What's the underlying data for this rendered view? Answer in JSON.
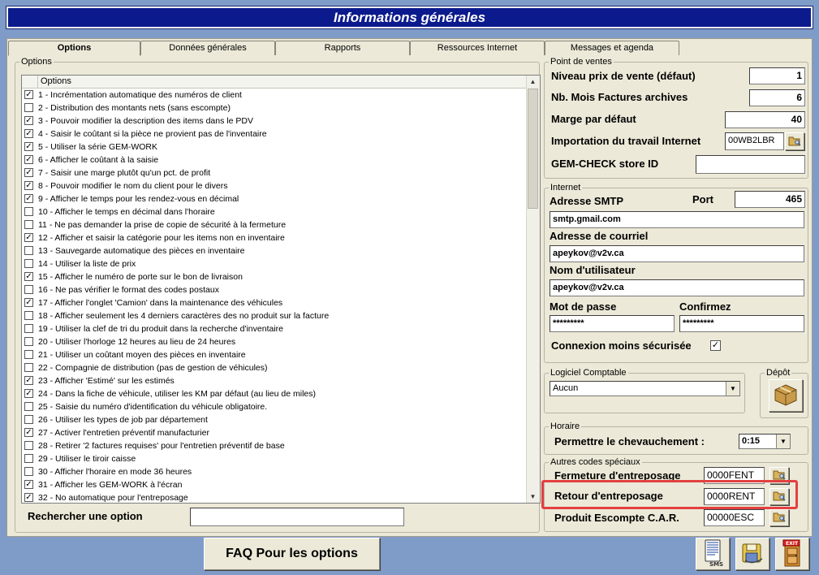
{
  "window": {
    "title": "Informations générales"
  },
  "tabs": [
    {
      "label": "Options"
    },
    {
      "label": "Données générales"
    },
    {
      "label": "Rapports"
    },
    {
      "label": "Ressources Internet"
    },
    {
      "label": "Messages et agenda"
    }
  ],
  "options_group": {
    "label": "Options",
    "column_header": "Options",
    "items": [
      {
        "text": "1 - Incrémentation automatique des numéros de client",
        "checked": true
      },
      {
        "text": "2 - Distribution des montants nets (sans escompte)",
        "checked": false
      },
      {
        "text": "3 - Pouvoir modifier la description des items dans le PDV",
        "checked": true
      },
      {
        "text": "4 - Saisir le coûtant si la pièce ne provient pas de l'inventaire",
        "checked": true
      },
      {
        "text": "5 - Utiliser la série GEM-WORK",
        "checked": true
      },
      {
        "text": "6 - Afficher le coûtant à la saisie",
        "checked": true
      },
      {
        "text": "7 - Saisir une marge plutôt qu'un pct. de profit",
        "checked": true
      },
      {
        "text": "8 - Pouvoir modifier le nom du client pour le divers",
        "checked": true
      },
      {
        "text": "9 - Afficher le temps pour les rendez-vous en décimal",
        "checked": true
      },
      {
        "text": "10 - Afficher le temps en décimal dans l'horaire",
        "checked": false
      },
      {
        "text": "11 - Ne pas demander la prise de copie de sécurité à la fermeture",
        "checked": false
      },
      {
        "text": "12 - Afficher et saisir la catégorie pour les items non en inventaire",
        "checked": true
      },
      {
        "text": "13 - Sauvegarde automatique des pièces en inventaire",
        "checked": false
      },
      {
        "text": "14 - Utiliser la liste de prix",
        "checked": false
      },
      {
        "text": "15 - Afficher le numéro de porte sur le bon de livraison",
        "checked": true
      },
      {
        "text": "16 - Ne pas vérifier le format des codes postaux",
        "checked": false
      },
      {
        "text": "17 - Afficher l'onglet 'Camion' dans la maintenance des véhicules",
        "checked": true
      },
      {
        "text": "18 - Afficher seulement les 4 derniers caractères des no produit sur la facture",
        "checked": false
      },
      {
        "text": "19 - Utiliser la clef de tri du produit dans la recherche d'inventaire",
        "checked": false
      },
      {
        "text": "20 - Utiliser l'horloge 12 heures au lieu de 24 heures",
        "checked": false
      },
      {
        "text": "21 - Utiliser un coûtant moyen des pièces en inventaire",
        "checked": false
      },
      {
        "text": "22 - Compagnie de distribution (pas de gestion de véhicules)",
        "checked": false
      },
      {
        "text": "23 - Afficher 'Estimé' sur les estimés",
        "checked": true
      },
      {
        "text": "24 - Dans la fiche de véhicule, utiliser les KM par défaut (au lieu de miles)",
        "checked": true
      },
      {
        "text": "25 - Saisie du numéro d'identification du véhicule obligatoire.",
        "checked": false
      },
      {
        "text": "26 - Utiliser les types de job par département",
        "checked": false
      },
      {
        "text": "27 - Activer l'entretien préventif manufacturier",
        "checked": true
      },
      {
        "text": "28 - Retirer '2 factures requises' pour l'entretien préventif de base",
        "checked": false
      },
      {
        "text": "29 - Utiliser le tiroir caisse",
        "checked": false
      },
      {
        "text": "30 - Afficher l'horaire en mode 36 heures",
        "checked": false
      },
      {
        "text": "31 - Afficher les GEM-WORK à l'écran",
        "checked": true
      },
      {
        "text": "32 - No automatique pour l'entreposage",
        "checked": true
      }
    ],
    "search_label": "Rechercher une option",
    "search_value": ""
  },
  "point_de_ventes": {
    "label": "Point de ventes",
    "niveau_prix_label": "Niveau prix de vente (défaut)",
    "niveau_prix_value": "1",
    "nb_mois_label": "Nb. Mois Factures archives",
    "nb_mois_value": "6",
    "marge_label": "Marge par défaut",
    "marge_value": "40",
    "importation_label": "Importation du travail Internet",
    "importation_value": "00WB2LBR",
    "gemcheck_label": "GEM-CHECK store ID",
    "gemcheck_value": ""
  },
  "internet": {
    "label": "Internet",
    "smtp_label": "Adresse SMTP",
    "port_label": "Port",
    "port_value": "465",
    "smtp_value": "smtp.gmail.com",
    "courriel_label": "Adresse de courriel",
    "courriel_value": "apeykov@v2v.ca",
    "utilisateur_label": "Nom d'utilisateur",
    "utilisateur_value": "apeykov@v2v.ca",
    "motdepasse_label": "Mot de passe",
    "motdepasse_value": "*********",
    "confirmez_label": "Confirmez",
    "confirmez_value": "*********",
    "connexion_label": "Connexion moins sécurisée",
    "connexion_checked": true
  },
  "logiciel": {
    "label": "Logiciel Comptable",
    "value": "Aucun"
  },
  "depot": {
    "label": "Dépôt"
  },
  "horaire": {
    "label": "Horaire",
    "chevauchement_label": "Permettre le chevauchement :",
    "chevauchement_value": "0:15"
  },
  "autres_codes": {
    "label": "Autres codes spéciaux",
    "items": [
      {
        "label": "Fermeture d'entreposage",
        "value": "0000FENT"
      },
      {
        "label": "Retour d'entreposage",
        "value": "0000RENT"
      },
      {
        "label": "Produit Escompte C.A.R.",
        "value": "00000ESC"
      }
    ]
  },
  "footer": {
    "faq_label": "FAQ Pour les options"
  }
}
